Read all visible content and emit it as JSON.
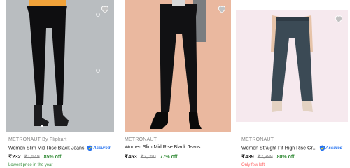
{
  "products": [
    {
      "brand": "METRONAUT By Flipkart",
      "title": "Women Slim Mid Rise Black Jeans",
      "assured": "Assured",
      "price": "₹232",
      "mrp": "₹1,549",
      "discount": "85% off",
      "note": "Lowest price in the year",
      "image_bg": "#b7bbbe"
    },
    {
      "brand": "METRONAUT",
      "title": "Women Slim Mid Rise Black Jeans",
      "price": "₹453",
      "mrp": "₹2,050",
      "discount": "77% off",
      "image_bg": "#eab89f"
    },
    {
      "brand": "METRONAUT",
      "title": "Women Straight Fit High Rise Gr...",
      "assured": "Assured",
      "price": "₹439",
      "mrp": "₹2,399",
      "discount": "80% off",
      "note": "Only few left",
      "image_bg": "#f6e9ee"
    }
  ],
  "colors": {
    "price_green": "#388e3c",
    "assured_blue": "#2874f0",
    "alert_red": "#ff6161"
  }
}
